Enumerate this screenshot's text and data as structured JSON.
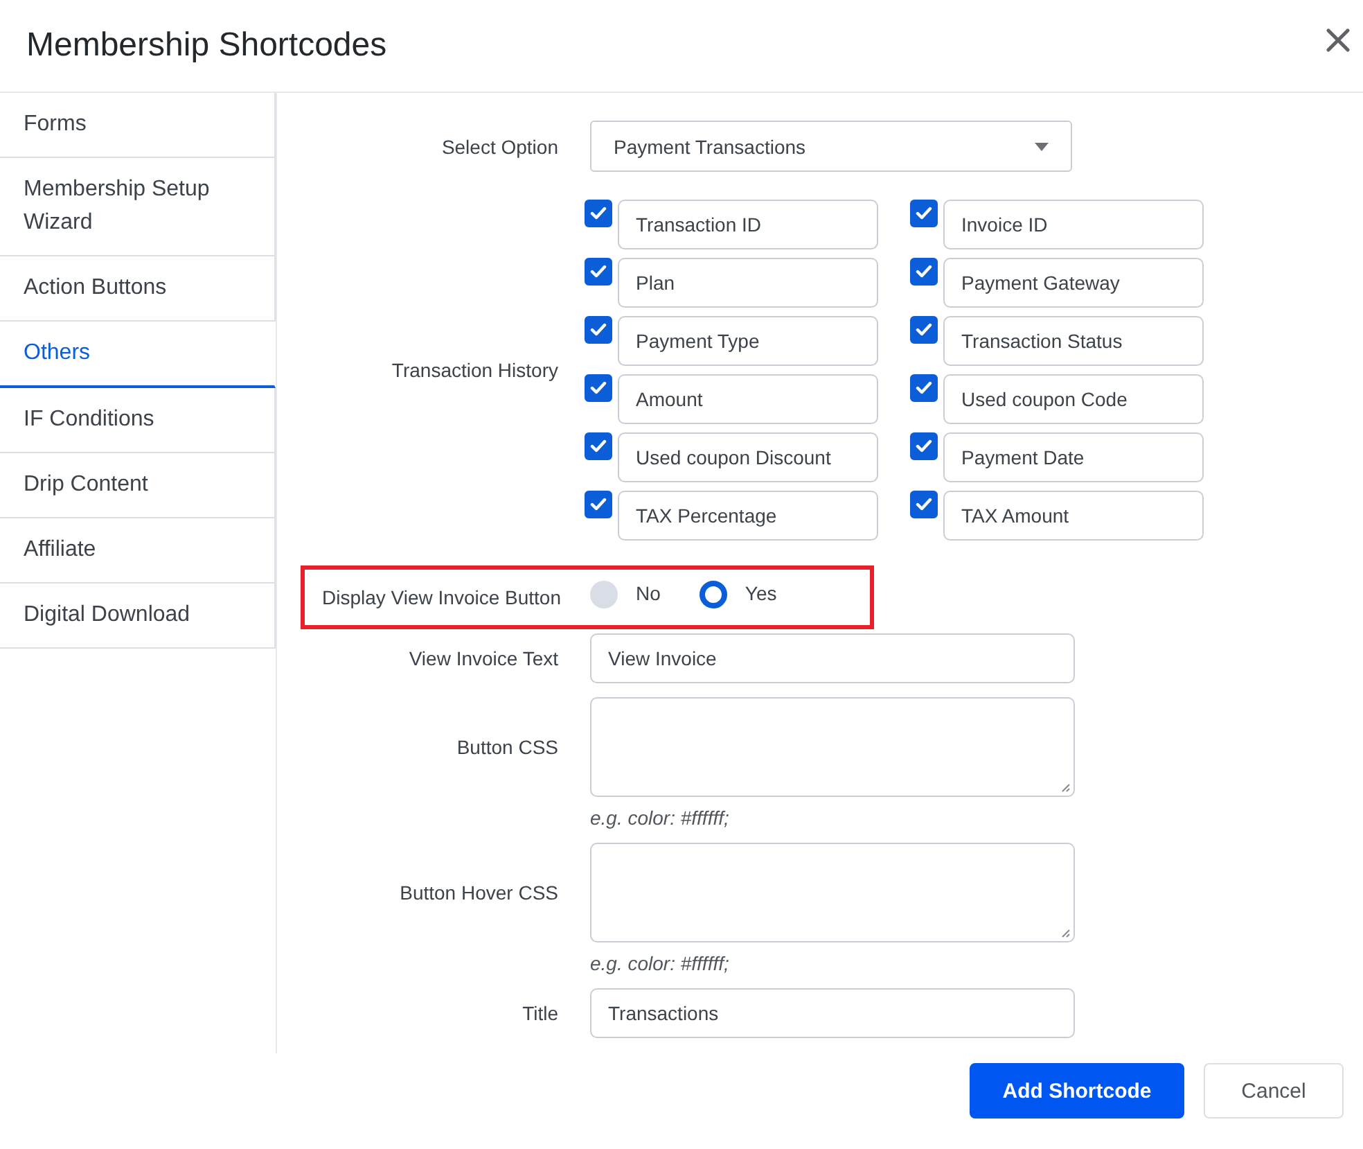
{
  "dialog": {
    "title": "Membership Shortcodes"
  },
  "sidebar": {
    "items": [
      {
        "label": "Forms",
        "selected": false
      },
      {
        "label": "Membership Setup Wizard",
        "selected": false
      },
      {
        "label": "Action Buttons",
        "selected": false
      },
      {
        "label": "Others",
        "selected": true
      },
      {
        "label": "IF Conditions",
        "selected": false
      },
      {
        "label": "Drip Content",
        "selected": false
      },
      {
        "label": "Affiliate",
        "selected": false
      },
      {
        "label": "Digital Download",
        "selected": false
      }
    ]
  },
  "select_option": {
    "label": "Select Option",
    "value": "Payment Transactions"
  },
  "transaction_history": {
    "label": "Transaction History",
    "fields": [
      {
        "label": "Transaction ID",
        "checked": true
      },
      {
        "label": "Invoice ID",
        "checked": true
      },
      {
        "label": "Plan",
        "checked": true
      },
      {
        "label": "Payment Gateway",
        "checked": true
      },
      {
        "label": "Payment Type",
        "checked": true
      },
      {
        "label": "Transaction Status",
        "checked": true
      },
      {
        "label": "Amount",
        "checked": true
      },
      {
        "label": "Used coupon Code",
        "checked": true
      },
      {
        "label": "Used coupon Discount",
        "checked": true
      },
      {
        "label": "Payment Date",
        "checked": true
      },
      {
        "label": "TAX Percentage",
        "checked": true
      },
      {
        "label": "TAX Amount",
        "checked": true
      }
    ]
  },
  "display_view_invoice_button": {
    "label": "Display View Invoice Button",
    "highlighted": true,
    "options": [
      {
        "label": "No",
        "selected": false
      },
      {
        "label": "Yes",
        "selected": true
      }
    ]
  },
  "view_invoice_text": {
    "label": "View Invoice Text",
    "value": "View Invoice"
  },
  "button_css": {
    "label": "Button CSS",
    "hint": "e.g. color: #ffffff;"
  },
  "button_hover_css": {
    "label": "Button Hover CSS",
    "hint": "e.g. color: #ffffff;"
  },
  "title": {
    "label": "Title",
    "value": "Transactions"
  },
  "buttons": [
    {
      "label": "Add Shortcode",
      "kind": "primary"
    },
    {
      "label": "Cancel",
      "kind": "secondary"
    }
  ]
}
